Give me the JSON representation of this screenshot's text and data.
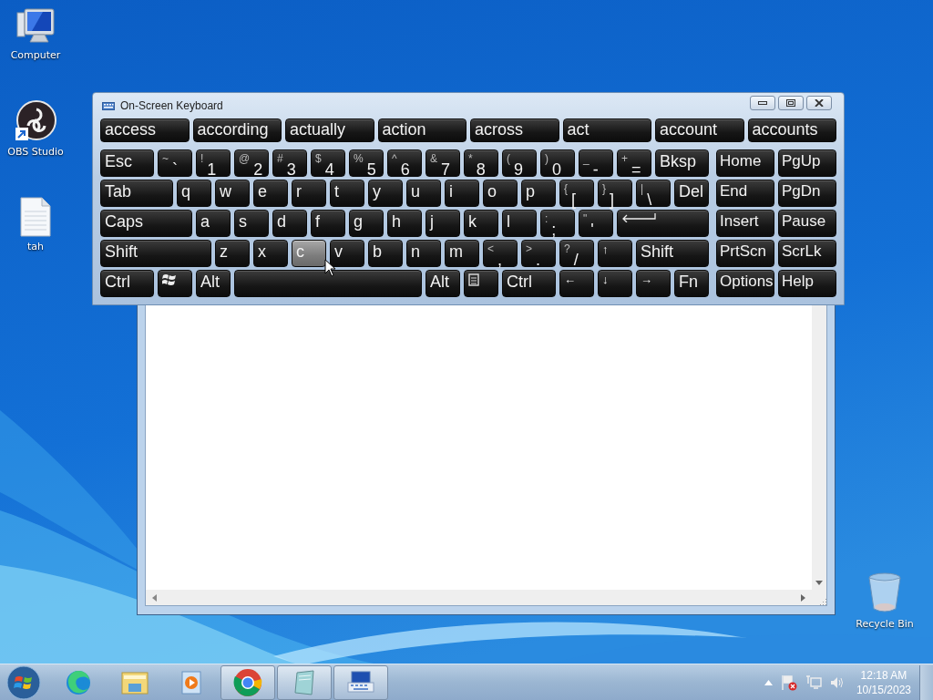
{
  "desktop_icons": [
    {
      "kind": "computer",
      "label": "Computer"
    },
    {
      "kind": "obs",
      "label": "OBS Studio"
    },
    {
      "kind": "document",
      "label": "tah"
    },
    {
      "kind": "recycle",
      "label": "Recycle Bin"
    }
  ],
  "keyboard": {
    "title": "On-Screen Keyboard",
    "predictions": [
      "access",
      "according",
      "actually",
      "action",
      "across",
      "act",
      "account",
      "accounts"
    ],
    "rows": [
      {
        "keys": [
          {
            "kind": "text",
            "label": "Esc",
            "hovered": false
          },
          {
            "kind": "dual",
            "shift": "~",
            "label": "`",
            "hovered": false
          },
          {
            "kind": "dual",
            "shift": "!",
            "label": "1",
            "hovered": false
          },
          {
            "kind": "dual",
            "shift": "@",
            "label": "2",
            "hovered": false
          },
          {
            "kind": "dual",
            "shift": "#",
            "label": "3",
            "hovered": false
          },
          {
            "kind": "dual",
            "shift": "$",
            "label": "4",
            "hovered": false
          },
          {
            "kind": "dual",
            "shift": "%",
            "label": "5",
            "hovered": false
          },
          {
            "kind": "dual",
            "shift": "^",
            "label": "6",
            "hovered": false
          },
          {
            "kind": "dual",
            "shift": "&",
            "label": "7",
            "hovered": false
          },
          {
            "kind": "dual",
            "shift": "*",
            "label": "8",
            "hovered": false
          },
          {
            "kind": "dual",
            "shift": "(",
            "label": "9",
            "hovered": false
          },
          {
            "kind": "dual",
            "shift": ")",
            "label": "0",
            "hovered": false
          },
          {
            "kind": "dual",
            "shift": "_",
            "label": "-",
            "hovered": false
          },
          {
            "kind": "dual",
            "shift": "+",
            "label": "=",
            "hovered": false
          },
          {
            "kind": "text",
            "label": "Bksp",
            "hovered": false
          }
        ]
      },
      {
        "keys": [
          {
            "kind": "text",
            "label": "Tab",
            "hovered": false
          },
          {
            "kind": "text",
            "label": "q",
            "hovered": false
          },
          {
            "kind": "text",
            "label": "w",
            "hovered": false
          },
          {
            "kind": "text",
            "label": "e",
            "hovered": false
          },
          {
            "kind": "text",
            "label": "r",
            "hovered": false
          },
          {
            "kind": "text",
            "label": "t",
            "hovered": false
          },
          {
            "kind": "text",
            "label": "y",
            "hovered": false
          },
          {
            "kind": "text",
            "label": "u",
            "hovered": false
          },
          {
            "kind": "text",
            "label": "i",
            "hovered": false
          },
          {
            "kind": "text",
            "label": "o",
            "hovered": false
          },
          {
            "kind": "text",
            "label": "p",
            "hovered": false
          },
          {
            "kind": "dual",
            "shift": "{",
            "label": "[",
            "hovered": false
          },
          {
            "kind": "dual",
            "shift": "}",
            "label": "]",
            "hovered": false
          },
          {
            "kind": "dual",
            "shift": "|",
            "label": "\\",
            "hovered": false
          },
          {
            "kind": "text",
            "label": "Del",
            "hovered": false
          }
        ]
      },
      {
        "keys": [
          {
            "kind": "text",
            "label": "Caps",
            "hovered": false
          },
          {
            "kind": "text",
            "label": "a",
            "hovered": false
          },
          {
            "kind": "text",
            "label": "s",
            "hovered": false
          },
          {
            "kind": "text",
            "label": "d",
            "hovered": false
          },
          {
            "kind": "text",
            "label": "f",
            "hovered": false
          },
          {
            "kind": "text",
            "label": "g",
            "hovered": false
          },
          {
            "kind": "text",
            "label": "h",
            "hovered": false
          },
          {
            "kind": "text",
            "label": "j",
            "hovered": false
          },
          {
            "kind": "text",
            "label": "k",
            "hovered": false
          },
          {
            "kind": "text",
            "label": "l",
            "hovered": false
          },
          {
            "kind": "dual",
            "shift": ":",
            "label": ";",
            "hovered": false
          },
          {
            "kind": "dual",
            "shift": "\"",
            "label": "'",
            "hovered": false
          },
          {
            "kind": "enter",
            "hovered": false
          }
        ]
      },
      {
        "keys": [
          {
            "kind": "text",
            "label": "Shift",
            "hovered": false
          },
          {
            "kind": "text",
            "label": "z",
            "hovered": false
          },
          {
            "kind": "text",
            "label": "x",
            "hovered": false
          },
          {
            "kind": "text",
            "label": "c",
            "hovered": true
          },
          {
            "kind": "text",
            "label": "v",
            "hovered": false
          },
          {
            "kind": "text",
            "label": "b",
            "hovered": false
          },
          {
            "kind": "text",
            "label": "n",
            "hovered": false
          },
          {
            "kind": "text",
            "label": "m",
            "hovered": false
          },
          {
            "kind": "dual",
            "shift": "<",
            "label": ",",
            "hovered": false
          },
          {
            "kind": "dual",
            "shift": ">",
            "label": ".",
            "hovered": false
          },
          {
            "kind": "dual",
            "shift": "?",
            "label": "/",
            "hovered": false
          },
          {
            "kind": "arrow",
            "label": "↑",
            "hovered": false
          },
          {
            "kind": "text",
            "label": "Shift",
            "hovered": false
          }
        ]
      },
      {
        "keys": [
          {
            "kind": "text",
            "label": "Ctrl",
            "hovered": false
          },
          {
            "kind": "windows",
            "hovered": false
          },
          {
            "kind": "text",
            "label": "Alt",
            "hovered": false
          },
          {
            "kind": "space",
            "hovered": false
          },
          {
            "kind": "text",
            "label": "Alt",
            "hovered": false
          },
          {
            "kind": "menu",
            "hovered": false
          },
          {
            "kind": "text",
            "label": "Ctrl",
            "hovered": false
          },
          {
            "kind": "arrow",
            "label": "←",
            "hovered": false
          },
          {
            "kind": "arrow",
            "label": "↓",
            "hovered": false
          },
          {
            "kind": "arrow",
            "label": "→",
            "hovered": false
          },
          {
            "kind": "text",
            "label": "Fn",
            "hovered": false
          }
        ]
      }
    ],
    "nav_keys": [
      "Home",
      "PgUp",
      "End",
      "PgDn",
      "Insert",
      "Pause",
      "PrtScn",
      "ScrLk",
      "Options",
      "Help"
    ]
  },
  "taskbar": {
    "apps": [
      {
        "kind": "edge",
        "open": false
      },
      {
        "kind": "explorer",
        "open": false
      },
      {
        "kind": "media",
        "open": false
      },
      {
        "kind": "chrome",
        "open": true
      },
      {
        "kind": "notepad",
        "open": true
      },
      {
        "kind": "keyboard",
        "open": true
      }
    ],
    "time": "12:18 AM",
    "date": "10/15/2023"
  }
}
